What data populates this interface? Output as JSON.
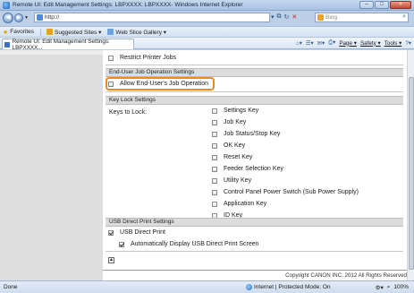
{
  "window": {
    "title": "Remote UI: Edit Management Settings: LBPXXXX: LBPXXXX- Windows Internet Explorer",
    "minimize": "–",
    "maximize": "□",
    "close": "×"
  },
  "address_bar": {
    "url": "http://",
    "search_placeholder": "Bing"
  },
  "favorites_bar": {
    "favorites_label": "Favorites",
    "suggested_sites": "Suggested Sites ▾",
    "web_slice_gallery": "Web Slice Gallery ▾"
  },
  "tab": {
    "title": "Remote UI: Edit Management Settings: LBPXXXX..."
  },
  "command_bar": {
    "page": "Page ▾",
    "safety": "Safety ▾",
    "tools": "Tools ▾"
  },
  "settings": {
    "restrict_printer_jobs": "Restrict Printer Jobs",
    "end_user_section": "End-User Job Operation Settings",
    "allow_end_user_job": "Allow End-User's Job Operation",
    "key_lock_section": "Key Lock Settings",
    "keys_to_lock_label": "Keys to Lock:",
    "keys": [
      {
        "label": "Settings Key",
        "checked": false
      },
      {
        "label": "Job Key",
        "checked": false
      },
      {
        "label": "Job Status/Stop Key",
        "checked": false
      },
      {
        "label": "OK Key",
        "checked": false
      },
      {
        "label": "Reset Key",
        "checked": false
      },
      {
        "label": "Feeder Selection Key",
        "checked": false
      },
      {
        "label": "Utility Key",
        "checked": false
      },
      {
        "label": "Control Panel Power Switch (Sub Power Supply)",
        "checked": false
      },
      {
        "label": "Application Key",
        "checked": false
      },
      {
        "label": "ID Key",
        "checked": false
      }
    ],
    "usb_section": "USB Direct Print Settings",
    "usb_direct_print": "USB Direct Print",
    "usb_direct_print_checked": true,
    "auto_display_usb": "Automatically Display USB Direct Print Screen",
    "auto_display_usb_checked": true
  },
  "footer": {
    "copyright": "Copyright CANON INC. 2012 All Rights Reserved"
  },
  "status_bar": {
    "status": "Done",
    "zone": "Internet | Protected Mode: On",
    "zoom": "100%"
  },
  "colors": {
    "highlight_border": "#f0891a",
    "section_header_bg": "#dcdcdc",
    "left_pane_bg": "#dedede"
  }
}
